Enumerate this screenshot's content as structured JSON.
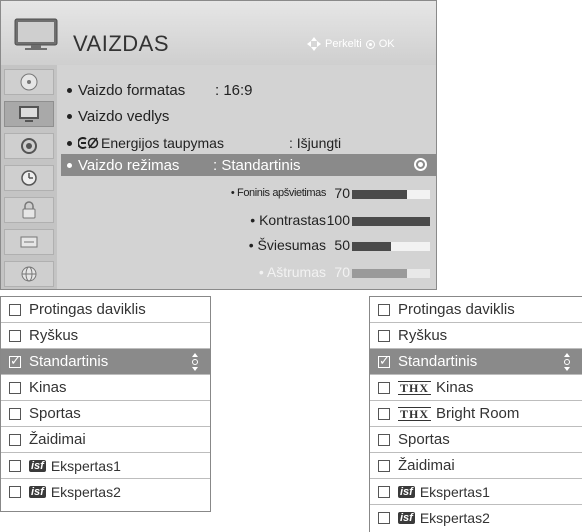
{
  "menu": {
    "title": "VAIZDAS",
    "nav_hint": "Perkelti",
    "ok_label": "OK",
    "sidebar_icons": [
      "disc-icon",
      "tv-picture-icon",
      "speaker-icon",
      "clock-icon",
      "lock-icon",
      "settings-icon",
      "globe-icon"
    ],
    "rows": {
      "format_label": "Vaizdo formatas",
      "format_value": ": 16:9",
      "wizard_label": "Vaizdo vedlys",
      "energy_label": "Energijos taupymas",
      "energy_value": ": Išjungti",
      "mode_label": "Vaizdo režimas",
      "mode_value": ": Standartinis"
    },
    "sliders": [
      {
        "label": "• Foninis apšvietimas",
        "value": "70",
        "level": 70
      },
      {
        "label": "• Kontrastas",
        "value": "100",
        "level": 100
      },
      {
        "label": "• Šviesumas",
        "value": "50",
        "level": 50
      },
      {
        "label": "• Aštrumas",
        "value": "70",
        "level": 70
      }
    ]
  },
  "list_left": {
    "items": [
      {
        "label": "Protingas daviklis"
      },
      {
        "label": "Ryškus"
      },
      {
        "label": "Standartinis",
        "selected": true
      },
      {
        "label": "Kinas"
      },
      {
        "label": "Sportas"
      },
      {
        "label": "Žaidimai"
      },
      {
        "label": "Ekspertas1",
        "badge": "isf"
      },
      {
        "label": "Ekspertas2",
        "badge": "isf"
      }
    ]
  },
  "list_right": {
    "items": [
      {
        "label": "Protingas daviklis"
      },
      {
        "label": "Ryškus"
      },
      {
        "label": "Standartinis",
        "selected": true
      },
      {
        "label": "Kinas",
        "badge": "THX"
      },
      {
        "label": "Bright Room",
        "badge": "THX"
      },
      {
        "label": "Sportas"
      },
      {
        "label": "Žaidimai"
      },
      {
        "label": "Ekspertas1",
        "badge": "isf"
      },
      {
        "label": "Ekspertas2",
        "badge": "isf"
      }
    ]
  },
  "colors": {
    "panel": "#d3d3d3",
    "highlight": "#8a8a8a",
    "slider_fill": "#4a4a4a"
  }
}
